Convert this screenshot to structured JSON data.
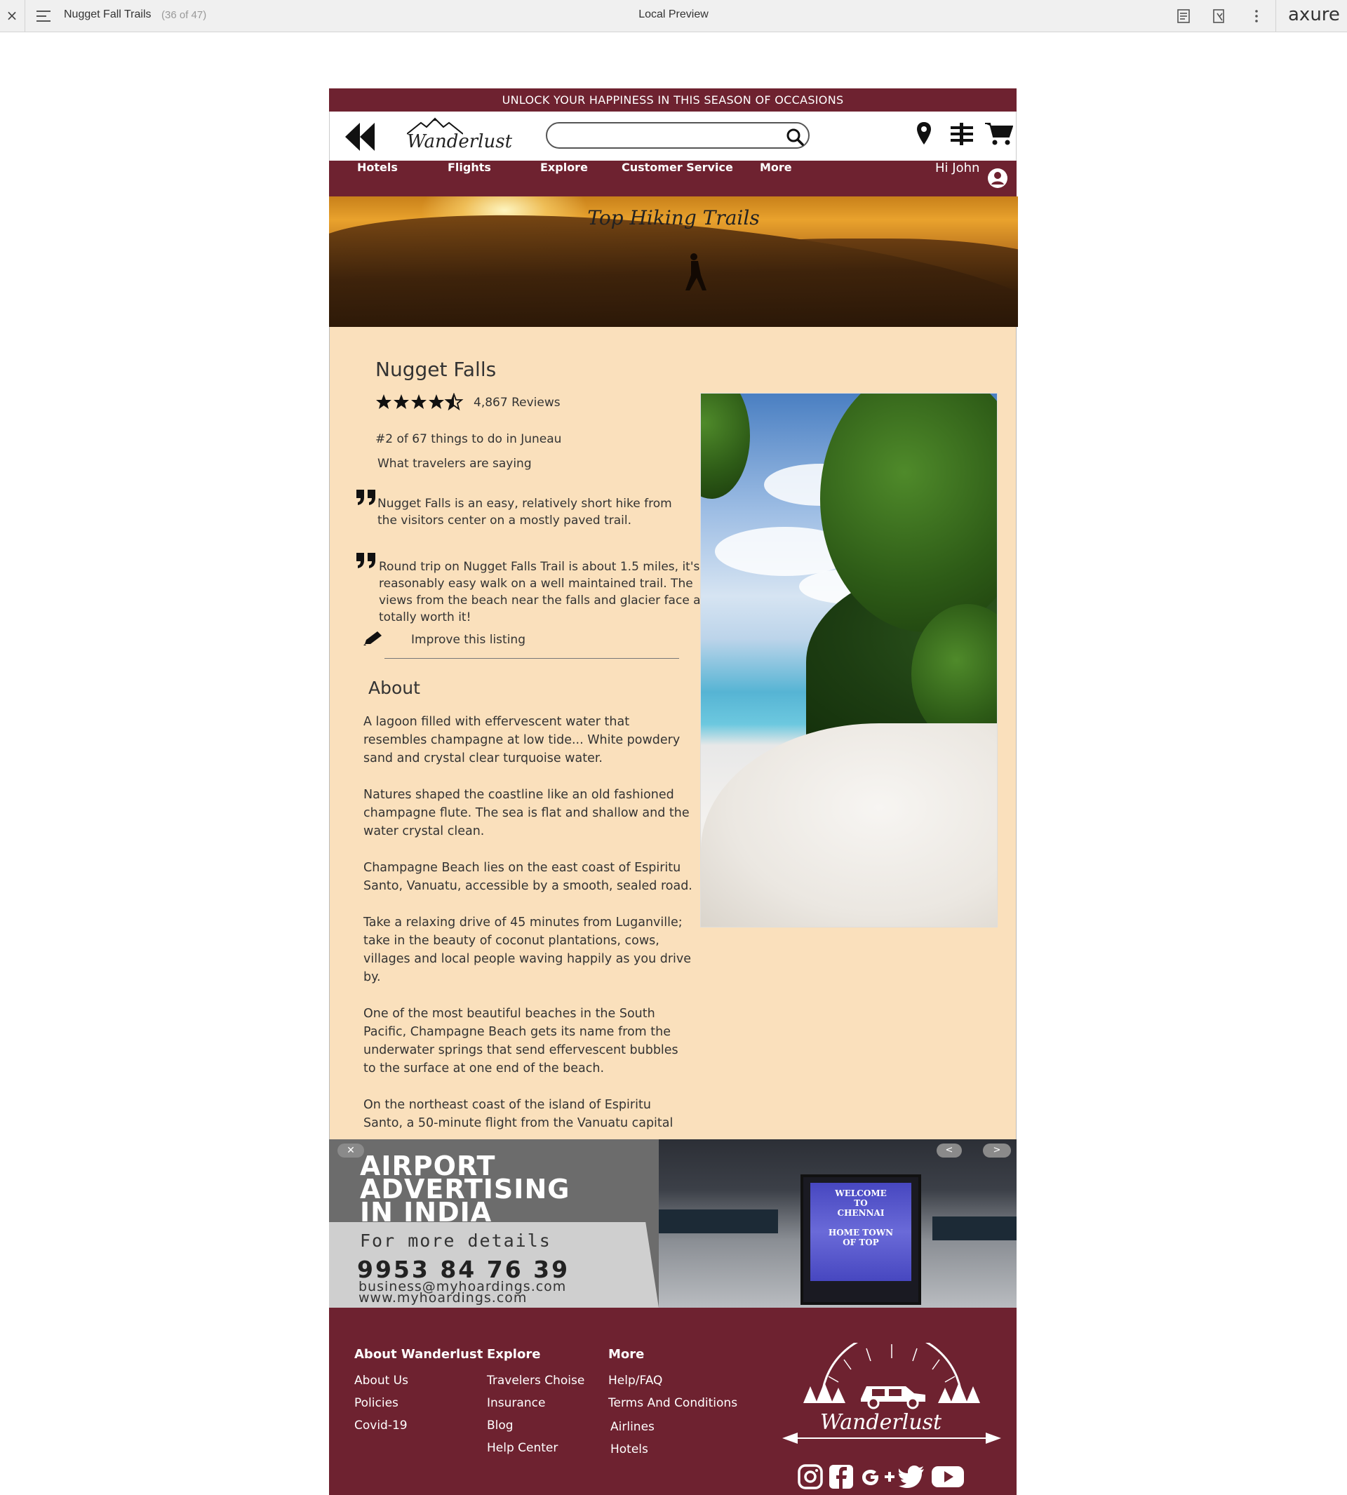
{
  "preview_bar": {
    "close": "×",
    "page_title": "Nugget Fall Trails",
    "page_count": "(36 of 47)",
    "center_title": "Local Preview",
    "brand": "axure",
    "icons": [
      "notes-icon",
      "inspect-icon",
      "more-icon"
    ]
  },
  "promo": {
    "text": "UNLOCK YOUR HAPPINESS IN THIS SEASON OF OCCASIONS"
  },
  "header": {
    "logo": "Wanderlust",
    "search_placeholder": "",
    "icons": [
      "back-icon",
      "search-icon",
      "location-icon",
      "filter-icon",
      "cart-icon"
    ]
  },
  "nav": {
    "items": [
      "Hotels",
      "Flights",
      "Explore",
      "Customer Service",
      "More"
    ],
    "greeting": "Hi John"
  },
  "hero": {
    "title": "Top Hiking Trails"
  },
  "listing": {
    "name": "Nugget Falls",
    "rating": 4.5,
    "rating_max": 5,
    "reviews": "4,867 Reviews",
    "rank": "#2 of 67 things to do in Juneau",
    "saying_heading": "What travelers are saying",
    "quotes": [
      "Nugget Falls is an easy, relatively short hike from\nthe visitors center on a mostly paved trail.",
      "Round trip on Nugget Falls Trail is about 1.5 miles, it's a\nreasonably easy walk on a well maintained trail. The\nviews from the beach near the falls and glacier face are\ntotally worth it!"
    ],
    "improve": "Improve this listing"
  },
  "about": {
    "title": "About",
    "paragraphs": [
      "A lagoon filled with effervescent water that resembles champagne at low tide... White powdery sand and crystal clear turquoise water.",
      "Natures shaped the coastline like an old fashioned champagne flute. The sea is flat and shallow and the water crystal clean.",
      "Champagne Beach lies on the east coast of Espiritu Santo, Vanuatu, accessible by a smooth, sealed road.",
      "Take a relaxing drive of 45 minutes from Luganville; take in the beauty of coconut plantations, cows, villages and local people waving happily as you drive by.",
      "One of the most beautiful beaches in the South Pacific, Champagne Beach gets its name from the underwater springs that send effervescent bubbles to the surface at one end of the beach.",
      "On the northeast coast of the island of Espiritu Santo, a 50-minute flight from the Vanuatu capital"
    ]
  },
  "ad": {
    "close": "✕",
    "prev": "<",
    "next": ">",
    "title": "AIRPORT\nADVERTISING\nIN INDIA",
    "more": "For more details",
    "phone": "9953 84 76 39",
    "email": "business@myhoardings.com",
    "web": "www.myhoardings.com",
    "screen_text": "WELCOME\nTO\nCHENNAI\n\nHOME TOWN\nOF TOP"
  },
  "footer": {
    "columns": [
      {
        "heading": "About Wanderlust",
        "links": [
          "About Us",
          "Policies",
          "Covid-19"
        ]
      },
      {
        "heading": "Explore",
        "links": [
          "Travelers Choise",
          "Insurance",
          "Blog",
          "Help Center"
        ]
      },
      {
        "heading": "More",
        "links": [
          "Help/FAQ",
          "Terms And Conditions",
          "Airlines",
          "Hotels"
        ]
      }
    ],
    "logo": "Wanderlust",
    "social": [
      "instagram-icon",
      "facebook-icon",
      "google-plus-icon",
      "twitter-icon",
      "youtube-icon"
    ]
  },
  "colors": {
    "brand": "#6e2230",
    "content_bg": "#fae0bc",
    "preview_bar": "#f0f0f0"
  }
}
